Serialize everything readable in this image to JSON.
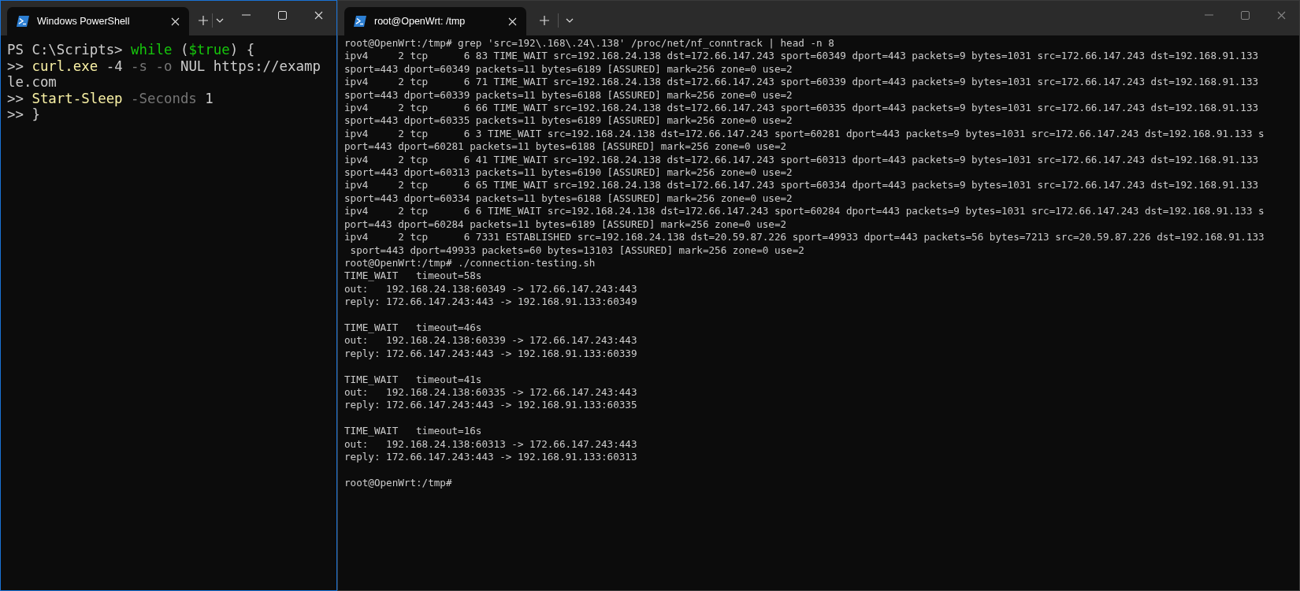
{
  "windows": [
    {
      "kind": "powershell",
      "focused": true,
      "tab_title": "Windows PowerShell",
      "lines": [
        [
          {
            "kind": "text",
            "text": "PS C:\\Scripts> "
          },
          {
            "kind": "keyword",
            "text": "while"
          },
          {
            "kind": "text",
            "text": " ("
          },
          {
            "kind": "variable",
            "text": "$true"
          },
          {
            "kind": "text",
            "text": ") {"
          }
        ],
        [
          {
            "kind": "text",
            "text": ">> "
          },
          {
            "kind": "command",
            "text": "curl.exe"
          },
          {
            "kind": "text",
            "text": " -4 "
          },
          {
            "kind": "parameter",
            "text": "-s -o"
          },
          {
            "kind": "text",
            "text": " NUL https://examp"
          }
        ],
        [
          {
            "kind": "text",
            "text": "le.com"
          }
        ],
        [
          {
            "kind": "text",
            "text": ">> "
          },
          {
            "kind": "command",
            "text": "Start-Sleep"
          },
          {
            "kind": "parameter",
            "text": " -Seconds"
          },
          {
            "kind": "text",
            "text": " 1"
          }
        ],
        [
          {
            "kind": "text",
            "text": ">> }"
          }
        ]
      ]
    },
    {
      "kind": "shell",
      "focused": false,
      "tab_title": "root@OpenWrt: /tmp",
      "blocks": [
        [
          "root@OpenWrt:/tmp# grep 'src=192\\.168\\.24\\.138' /proc/net/nf_conntrack | head -n 8",
          "ipv4     2 tcp      6 83 TIME_WAIT src=192.168.24.138 dst=172.66.147.243 sport=60349 dport=443 packets=9 bytes=1031 src=172.66.147.243 dst=192.168.91.133",
          "sport=443 dport=60349 packets=11 bytes=6189 [ASSURED] mark=256 zone=0 use=2",
          "ipv4     2 tcp      6 71 TIME_WAIT src=192.168.24.138 dst=172.66.147.243 sport=60339 dport=443 packets=9 bytes=1031 src=172.66.147.243 dst=192.168.91.133",
          "sport=443 dport=60339 packets=11 bytes=6188 [ASSURED] mark=256 zone=0 use=2",
          "ipv4     2 tcp      6 66 TIME_WAIT src=192.168.24.138 dst=172.66.147.243 sport=60335 dport=443 packets=9 bytes=1031 src=172.66.147.243 dst=192.168.91.133",
          "sport=443 dport=60335 packets=11 bytes=6189 [ASSURED] mark=256 zone=0 use=2",
          "ipv4     2 tcp      6 3 TIME_WAIT src=192.168.24.138 dst=172.66.147.243 sport=60281 dport=443 packets=9 bytes=1031 src=172.66.147.243 dst=192.168.91.133 s",
          "port=443 dport=60281 packets=11 bytes=6188 [ASSURED] mark=256 zone=0 use=2",
          "ipv4     2 tcp      6 41 TIME_WAIT src=192.168.24.138 dst=172.66.147.243 sport=60313 dport=443 packets=9 bytes=1031 src=172.66.147.243 dst=192.168.91.133",
          "sport=443 dport=60313 packets=11 bytes=6190 [ASSURED] mark=256 zone=0 use=2",
          "ipv4     2 tcp      6 65 TIME_WAIT src=192.168.24.138 dst=172.66.147.243 sport=60334 dport=443 packets=9 bytes=1031 src=172.66.147.243 dst=192.168.91.133",
          "sport=443 dport=60334 packets=11 bytes=6188 [ASSURED] mark=256 zone=0 use=2",
          "ipv4     2 tcp      6 6 TIME_WAIT src=192.168.24.138 dst=172.66.147.243 sport=60284 dport=443 packets=9 bytes=1031 src=172.66.147.243 dst=192.168.91.133 s",
          "port=443 dport=60284 packets=11 bytes=6189 [ASSURED] mark=256 zone=0 use=2",
          "ipv4     2 tcp      6 7331 ESTABLISHED src=192.168.24.138 dst=20.59.87.226 sport=49933 dport=443 packets=56 bytes=7213 src=20.59.87.226 dst=192.168.91.133",
          " sport=443 dport=49933 packets=60 bytes=13103 [ASSURED] mark=256 zone=0 use=2",
          "root@OpenWrt:/tmp# ./connection-testing.sh",
          "TIME_WAIT   timeout=58s",
          "out:   192.168.24.138:60349 -> 172.66.147.243:443",
          "reply: 172.66.147.243:443 -> 192.168.91.133:60349"
        ],
        [
          "TIME_WAIT   timeout=46s",
          "out:   192.168.24.138:60339 -> 172.66.147.243:443",
          "reply: 172.66.147.243:443 -> 192.168.91.133:60339"
        ],
        [
          "TIME_WAIT   timeout=41s",
          "out:   192.168.24.138:60335 -> 172.66.147.243:443",
          "reply: 172.66.147.243:443 -> 192.168.91.133:60335"
        ],
        [
          "TIME_WAIT   timeout=16s",
          "out:   192.168.24.138:60313 -> 172.66.147.243:443",
          "reply: 172.66.147.243:443 -> 192.168.91.133:60313"
        ],
        [
          "root@OpenWrt:/tmp#"
        ]
      ]
    }
  ]
}
